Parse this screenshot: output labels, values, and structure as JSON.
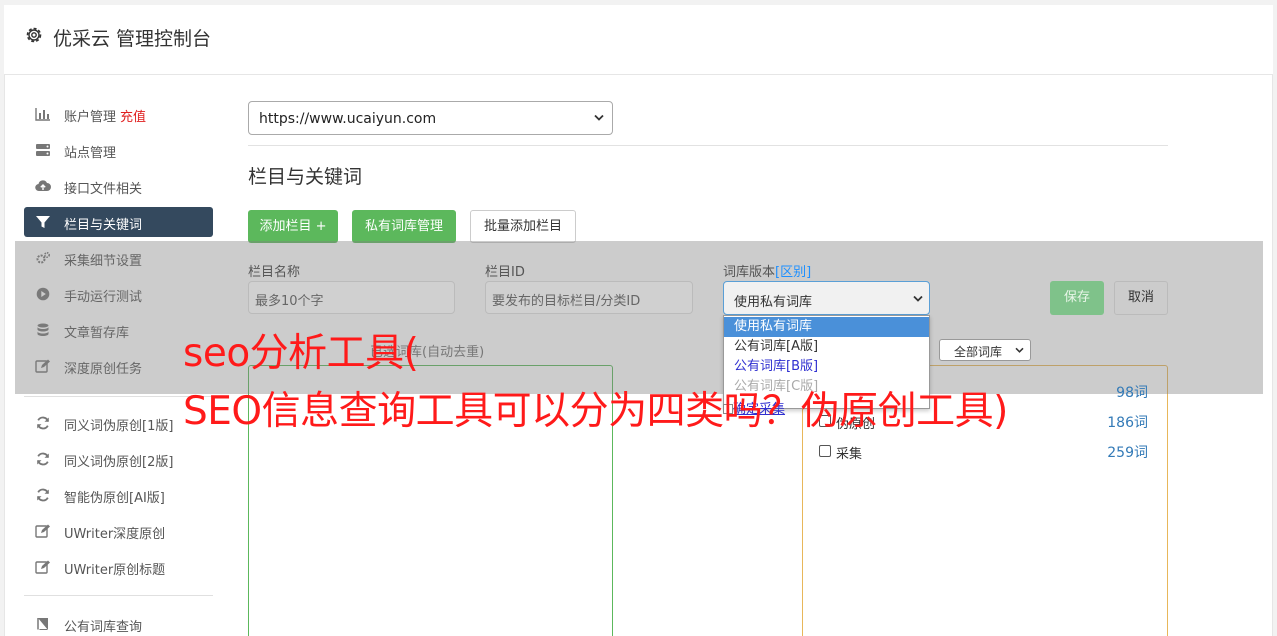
{
  "header": {
    "title": "优采云 管理控制台",
    "icon": "gear-icon"
  },
  "sidebar": {
    "items": [
      {
        "label": "账户管理",
        "extra": "充值",
        "icon": "bar-chart-icon"
      },
      {
        "label": "站点管理",
        "icon": "server-icon"
      },
      {
        "label": "接口文件相关",
        "icon": "cloud-upload-icon"
      },
      {
        "label": "栏目与关键词",
        "icon": "filter-icon",
        "active": true
      },
      {
        "label": "采集细节设置",
        "icon": "cogs-icon"
      },
      {
        "label": "手动运行测试",
        "icon": "play-circle-icon"
      },
      {
        "label": "文章暂存库",
        "icon": "database-icon"
      },
      {
        "label": "深度原创任务",
        "icon": "edit-icon"
      },
      {
        "label": "同义词伪原创[1版]",
        "icon": "refresh-icon"
      },
      {
        "label": "同义词伪原创[2版]",
        "icon": "refresh-icon"
      },
      {
        "label": "智能伪原创[AI版]",
        "icon": "refresh-icon"
      },
      {
        "label": "UWriter深度原创",
        "icon": "edit-icon"
      },
      {
        "label": "UWriter原创标题",
        "icon": "edit-icon"
      },
      {
        "label": "公有词库查询",
        "icon": "book-icon"
      }
    ]
  },
  "main": {
    "site_select": "https://www.ucaiyun.com",
    "section_title": "栏目与关键词",
    "buttons": {
      "add_column": "添加栏目 +",
      "private_lib": "私有词库管理",
      "batch_add": "批量添加栏目"
    },
    "form": {
      "name_label": "栏目名称",
      "name_placeholder": "最多10个字",
      "id_label": "栏目ID",
      "id_placeholder": "要发布的目标栏目/分类ID",
      "lib_label": "词库版本",
      "lib_label_link": "[区别]",
      "lib_value": "使用私有词库",
      "save": "保存",
      "cancel": "取消"
    },
    "dropdown_options": [
      "使用私有词库",
      "公有词库[A版]",
      "公有词库[B版]",
      "公有词库[C版]"
    ],
    "confirm_link": "确定采集",
    "list_caption": "已选词库(自动去重)",
    "all_lib": "全部词库",
    "libraries": [
      {
        "name": "",
        "count": "98词"
      },
      {
        "name": "伪原创",
        "count": "186词"
      },
      {
        "name": "采集",
        "count": "259词"
      }
    ]
  },
  "overlay": {
    "line1": "seo分析工具(",
    "line2": "SEO信息查询工具可以分为四类吗？伪原创工具)"
  }
}
